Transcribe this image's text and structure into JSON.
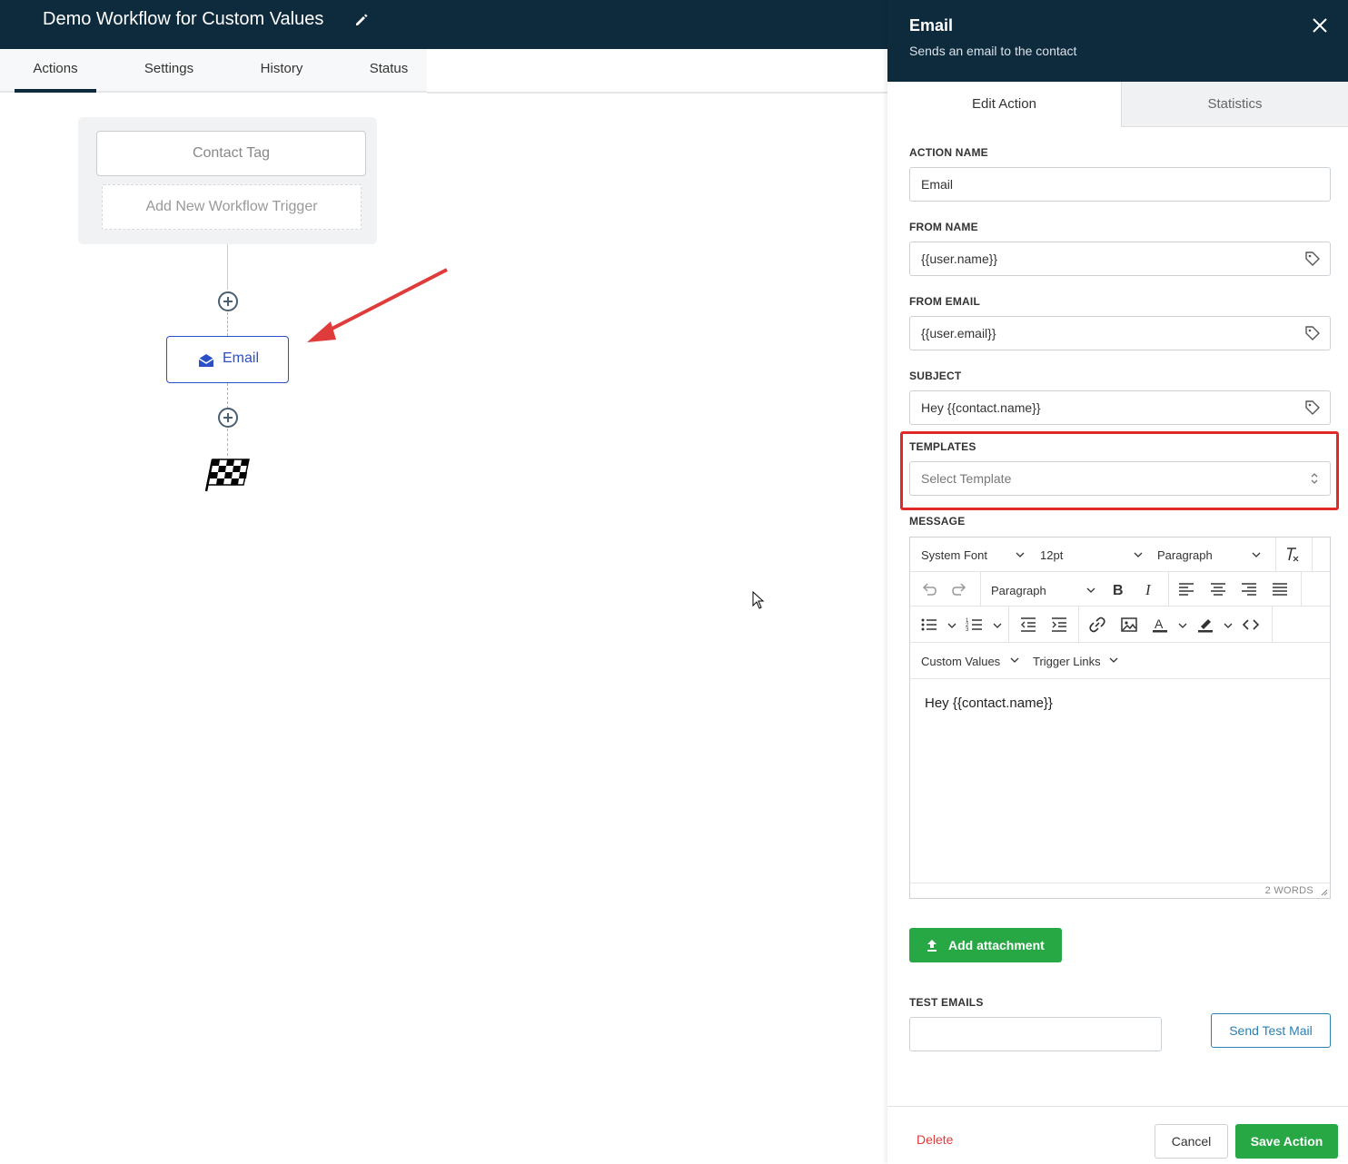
{
  "workflow": {
    "title": "Demo Workflow for Custom Values"
  },
  "tabs": [
    {
      "label": "Actions",
      "active": true
    },
    {
      "label": "Settings",
      "active": false
    },
    {
      "label": "History",
      "active": false
    },
    {
      "label": "Status",
      "active": false
    }
  ],
  "canvas": {
    "trigger_label": "Contact Tag",
    "add_trigger_label": "Add New Workflow Trigger",
    "action_node_label": "Email"
  },
  "panel": {
    "title": "Email",
    "subtitle": "Sends an email to the contact",
    "tabs": {
      "edit": "Edit Action",
      "stats": "Statistics"
    },
    "action_name": {
      "label": "ACTION NAME",
      "value": "Email"
    },
    "from_name": {
      "label": "FROM NAME",
      "value": "{{user.name}}"
    },
    "from_email": {
      "label": "FROM EMAIL",
      "value": "{{user.email}}"
    },
    "subject": {
      "label": "SUBJECT",
      "value": "Hey {{contact.name}}"
    },
    "templates": {
      "label": "TEMPLATES",
      "placeholder": "Select Template"
    },
    "message": {
      "label": "MESSAGE",
      "font": "System Font",
      "size": "12pt",
      "block_format_1": "Paragraph",
      "block_format_2": "Paragraph",
      "custom_values": "Custom Values",
      "trigger_links": "Trigger Links",
      "content": "Hey {{contact.name}}",
      "word_count": "2 WORDS"
    },
    "attachment_label": "Add attachment",
    "test_emails": {
      "label": "TEST EMAILS",
      "send_label": "Send Test Mail"
    },
    "footer": {
      "delete": "Delete",
      "cancel": "Cancel",
      "save": "Save Action"
    }
  },
  "colors": {
    "header_bg": "#0e2a3d",
    "accent_blue": "#2b4fc7",
    "green": "#28a745",
    "highlight_red": "#e02a2a",
    "delete_red": "#e03b3b"
  },
  "icons": [
    "pencil-icon",
    "envelope-open-icon",
    "checkered-flag-icon",
    "close-icon",
    "tag-icon",
    "upload-icon"
  ]
}
